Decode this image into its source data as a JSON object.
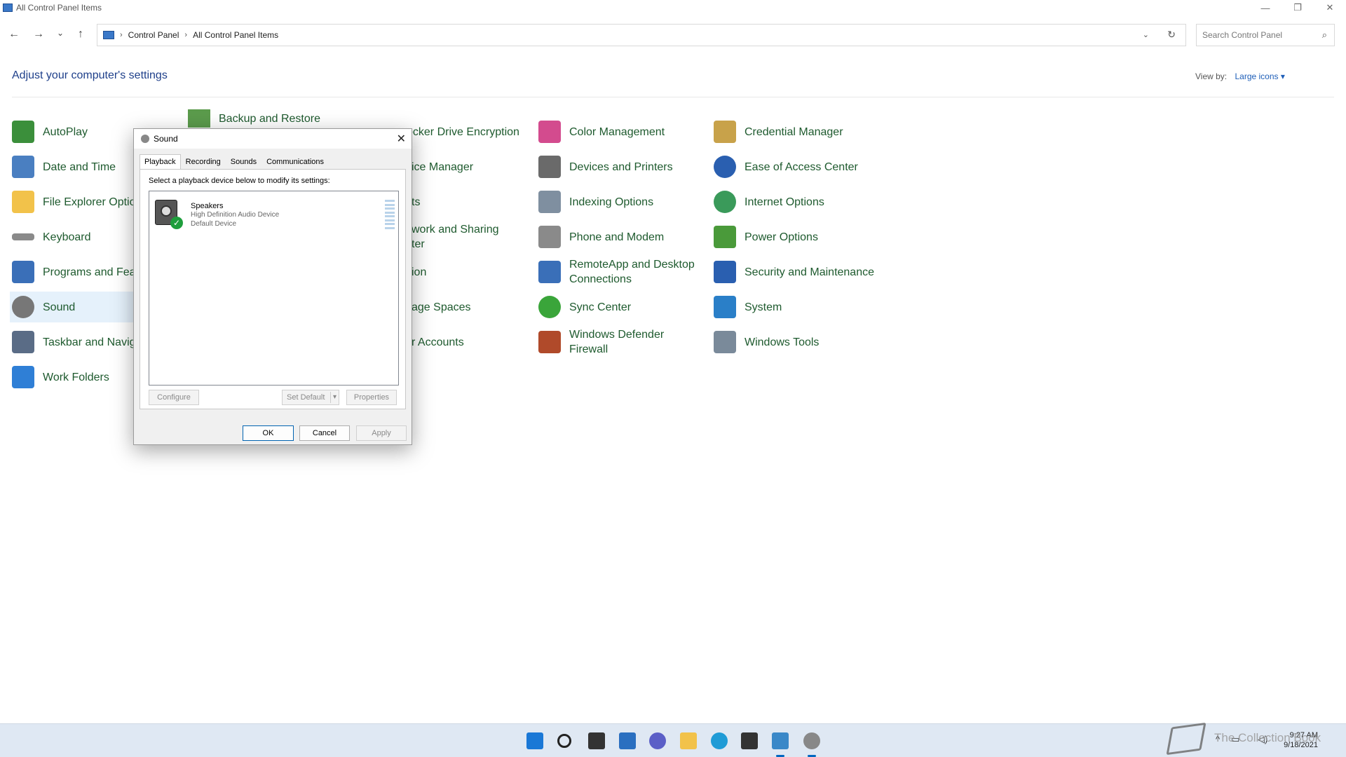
{
  "window": {
    "title": "All Control Panel Items",
    "minimize": "—",
    "restore": "❐",
    "close": "✕"
  },
  "nav": {
    "back": "←",
    "forward": "→",
    "recent": "⌄",
    "up": "↑",
    "breadcrumb": [
      "Control Panel",
      "All Control Panel Items"
    ],
    "separator": "›",
    "dropdown": "⌄",
    "refresh": "↻",
    "search_placeholder": "Search Control Panel",
    "search_icon": "⌕"
  },
  "main": {
    "heading": "Adjust your computer's settings",
    "view_by_label": "View by:",
    "view_by_value": "Large icons ▾"
  },
  "items": {
    "col1": [
      {
        "label": "AutoPlay",
        "icon": "autoplay-icon",
        "color": "#3b8f3b"
      },
      {
        "label": "Date and Time",
        "icon": "date-time-icon",
        "color": "#4a7fc1"
      },
      {
        "label": "File Explorer Optio",
        "icon": "folder-icon",
        "color": "#f2c24a"
      },
      {
        "label": "Keyboard",
        "icon": "keyboard-icon",
        "color": "#8a8a8a"
      },
      {
        "label": "Programs and Feat",
        "icon": "programs-icon",
        "color": "#3a6fb8"
      },
      {
        "label": "Sound",
        "icon": "speaker-icon",
        "color": "#777777"
      },
      {
        "label": "Taskbar and Navig",
        "icon": "taskbar-icon",
        "color": "#5a6c86"
      },
      {
        "label": "Work Folders",
        "icon": "work-folders-icon",
        "color": "#2f7fd6"
      }
    ],
    "col2": [
      {
        "label": "Backup and Restore",
        "icon": "backup-icon",
        "color": "#5b9b4c"
      }
    ],
    "col3": [
      {
        "label": "ocker Drive Encryption",
        "icon": "bitlocker-icon",
        "color": "#b8a27a"
      },
      {
        "label": "ice Manager",
        "icon": "device-manager-icon",
        "color": "#7a8fa8"
      },
      {
        "label": "ts",
        "icon": "fonts-icon",
        "color": "#c2a23a"
      },
      {
        "label": "work and Sharing",
        "label2": "ter",
        "icon": "network-icon",
        "color": "#3a7fc8"
      },
      {
        "label": "ion",
        "icon": "recovery-icon",
        "color": "#5a9a6a"
      },
      {
        "label": "age Spaces",
        "icon": "storage-icon",
        "color": "#7a7a7a"
      },
      {
        "label": "r Accounts",
        "icon": "user-accounts-icon",
        "color": "#3a88c8"
      }
    ],
    "col4": [
      {
        "label": "Color Management",
        "icon": "color-management-icon",
        "color": "#d34b8e"
      },
      {
        "label": "Devices and Printers",
        "icon": "printer-icon",
        "color": "#6a6a6a"
      },
      {
        "label": "Indexing Options",
        "icon": "indexing-icon",
        "color": "#7f8fa0"
      },
      {
        "label": "Phone and Modem",
        "icon": "phone-icon",
        "color": "#8a8a8a"
      },
      {
        "label": "RemoteApp and Desktop",
        "label2": "Connections",
        "icon": "remoteapp-icon",
        "color": "#3a6fb8"
      },
      {
        "label": "Sync Center",
        "icon": "sync-icon",
        "color": "#3aa53a"
      },
      {
        "label": "Windows Defender",
        "label2": "Firewall",
        "icon": "firewall-icon",
        "color": "#b04a2a"
      }
    ],
    "col5": [
      {
        "label": "Credential Manager",
        "icon": "credential-icon",
        "color": "#c8a24a"
      },
      {
        "label": "Ease of Access Center",
        "icon": "ease-of-access-icon",
        "color": "#2a5fb0"
      },
      {
        "label": "Internet Options",
        "icon": "internet-options-icon",
        "color": "#3a9a5a"
      },
      {
        "label": "Power Options",
        "icon": "power-icon",
        "color": "#4a9a3a"
      },
      {
        "label": "Security and Maintenance",
        "icon": "flag-icon",
        "color": "#2a5fb0"
      },
      {
        "label": "System",
        "icon": "system-icon",
        "color": "#2a7fc8"
      },
      {
        "label": "Windows Tools",
        "icon": "tools-icon",
        "color": "#7a8a9a"
      }
    ]
  },
  "dialog": {
    "title": "Sound",
    "close": "✕",
    "tabs": [
      "Playback",
      "Recording",
      "Sounds",
      "Communications"
    ],
    "instruction": "Select a playback device below to modify its settings:",
    "device": {
      "name": "Speakers",
      "driver": "High Definition Audio Device",
      "status": "Default Device",
      "check": "✓"
    },
    "configure": "Configure",
    "set_default": "Set Default",
    "set_default_arrow": "▾",
    "properties": "Properties",
    "ok": "OK",
    "cancel": "Cancel",
    "apply": "Apply"
  },
  "taskbar": {
    "time": "9:27 AM",
    "date": "9/18/2021",
    "watermark": "The Collection Book",
    "chevron": "^"
  }
}
